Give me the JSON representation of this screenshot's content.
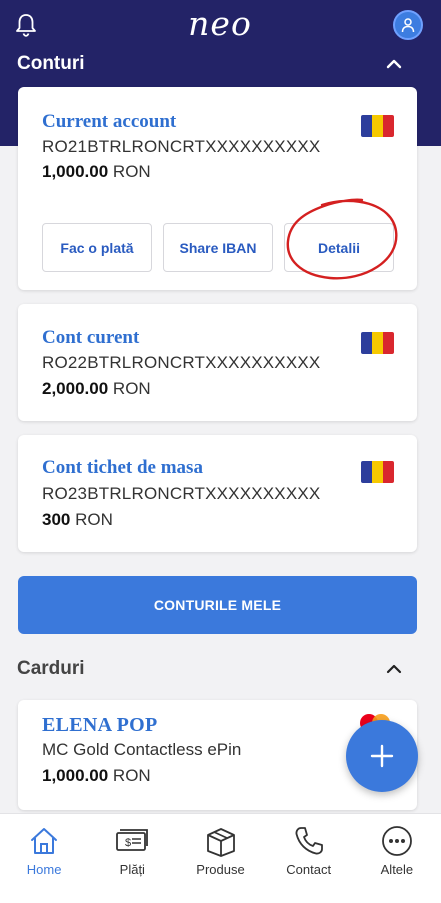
{
  "app": {
    "logo": "neo"
  },
  "colors": {
    "header_bg": "#232367",
    "accent": "#3b79dc",
    "title_blue": "#2f6fd0",
    "annotation_red": "#d42020"
  },
  "accounts_section": {
    "title": "Conturi",
    "toggle_icon": "chevron-up-icon"
  },
  "accounts": [
    {
      "title": "Current account",
      "iban": "RO21BTRLRONCRTXXXXXXXXXX",
      "balance_value": "1,000.00",
      "currency": "RON",
      "flag": "romania-flag-icon",
      "actions": [
        "Fac o plată",
        "Share IBAN",
        "Detalii"
      ]
    },
    {
      "title": "Cont curent",
      "iban": "RO22BTRLRONCRTXXXXXXXXXX",
      "balance_value": "2,000.00",
      "currency": "RON",
      "flag": "romania-flag-icon"
    },
    {
      "title": "Cont tichet de masa",
      "iban": "RO23BTRLRONCRTXXXXXXXXXX",
      "balance_value": "300",
      "currency": "RON",
      "flag": "romania-flag-icon"
    }
  ],
  "my_accounts_button": "CONTURILE MELE",
  "cards_section": {
    "title": "Carduri",
    "toggle_icon": "chevron-up-icon"
  },
  "cards": [
    {
      "holder": "ELENA POP",
      "type": "MC Gold Contactless ePin",
      "balance_value": "1,000.00",
      "currency": "RON",
      "brand_icon": "mastercard-icon"
    }
  ],
  "fab": {
    "icon": "plus-icon"
  },
  "bottom_nav": [
    {
      "label": "Home",
      "icon": "home-icon",
      "active": true
    },
    {
      "label": "Plăți",
      "icon": "payments-icon",
      "active": false
    },
    {
      "label": "Produse",
      "icon": "box-icon",
      "active": false
    },
    {
      "label": "Contact",
      "icon": "phone-icon",
      "active": false
    },
    {
      "label": "Altele",
      "icon": "more-icon",
      "active": false
    }
  ]
}
